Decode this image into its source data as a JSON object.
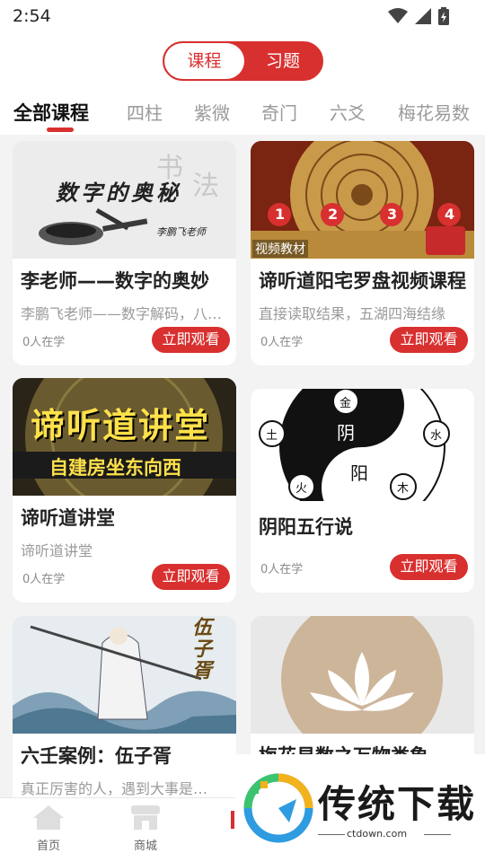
{
  "status_bar": {
    "time": "2:54"
  },
  "segment": {
    "course": "课程",
    "exercise": "习题"
  },
  "tabs": [
    "全部课程",
    "四柱",
    "紫微",
    "奇门",
    "六爻",
    "梅花易数"
  ],
  "thumb_text": {
    "c1_main": "数字的奥秘",
    "c1_teacher": "李鹏飞老师",
    "c2_badges": [
      "1",
      "2",
      "3",
      "4"
    ],
    "c2_label": "视频教材",
    "c3_line1": "谛听道讲堂",
    "c3_line2": "自建房坐东向西",
    "c4_yin": "阴",
    "c4_yang": "阳",
    "c4_elements": [
      "金",
      "水",
      "木",
      "火",
      "土"
    ],
    "c5_name": "伍子胥"
  },
  "cards": [
    {
      "title": "李老师——数字的奥妙",
      "subtitle": "李鹏飞老师——数字解码，八卦…",
      "learners": "0人在学",
      "button": "立即观看"
    },
    {
      "title": "谛听道阳宅罗盘视频课程",
      "subtitle": "直接读取结果，五湖四海结缘",
      "learners": "0人在学",
      "button": "立即观看"
    },
    {
      "title": "谛听道讲堂",
      "subtitle": "谛听道讲堂",
      "learners": "0人在学",
      "button": "立即观看"
    },
    {
      "title": "阴阳五行说",
      "subtitle": "",
      "learners": "0人在学",
      "button": "立即观看"
    },
    {
      "title": "六壬案例：伍子胥",
      "subtitle": "真正厉害的人，遇到大事是…",
      "learners": "",
      "button": ""
    },
    {
      "title": "梅花易数之万物类象",
      "subtitle": "",
      "learners": "",
      "button": ""
    }
  ],
  "bottom_nav": [
    {
      "label": "首页",
      "icon": "home-icon"
    },
    {
      "label": "商城",
      "icon": "shop-icon"
    },
    {
      "label": "",
      "icon": "course-icon"
    }
  ],
  "watermark": {
    "title": "传统下载",
    "url": "ctdown.com"
  },
  "colors": {
    "accent": "#d8302f",
    "background": "#f3f3f3"
  }
}
